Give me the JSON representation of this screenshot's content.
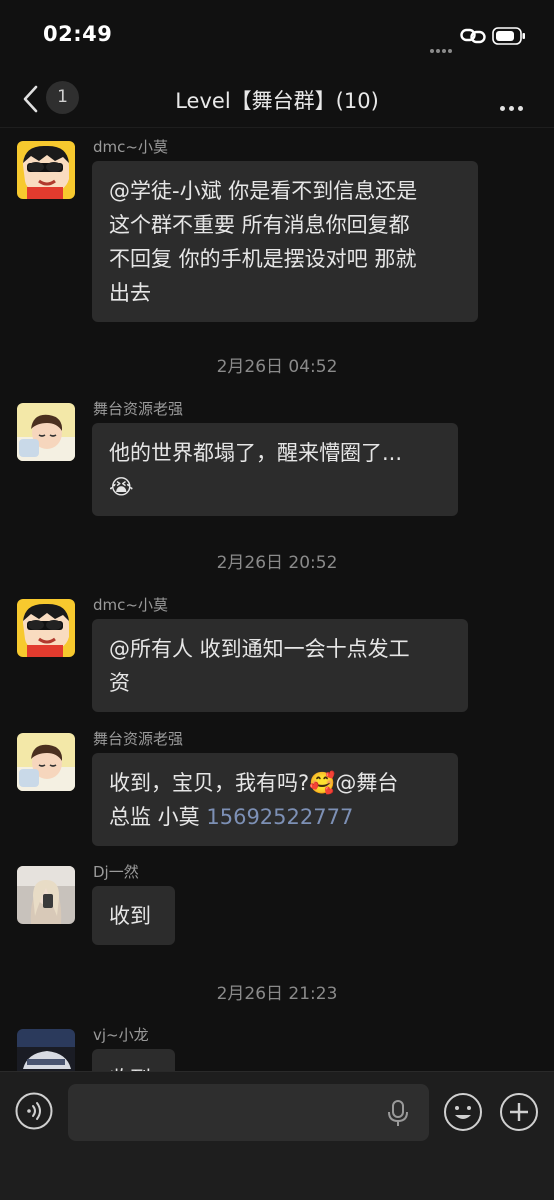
{
  "status_bar": {
    "time": "02:49"
  },
  "header": {
    "unread_count": "1",
    "title": "Level【舞台群】(10)"
  },
  "messages": [
    {
      "sender": "dmc~小莫",
      "avatar": "cartoon-boy-avatar",
      "lines": [
        "@学徒-小斌 你是看不到信息还是",
        "这个群不重要 所有消息你回复都",
        "不回复 你的手机是摆设对吧 那就",
        "出去"
      ]
    },
    {
      "sender": "舞台资源老强",
      "avatar": "sleeping-boy-avatar",
      "lines": [
        "他的世界都塌了，醒来懵圈了..."
      ],
      "emoji": "😭"
    },
    {
      "sender": "dmc~小莫",
      "avatar": "cartoon-boy-avatar",
      "lines": [
        "@所有人 收到通知一会十点发工",
        "资"
      ]
    },
    {
      "sender": "舞台资源老强",
      "avatar": "sleeping-boy-avatar",
      "line1": "收到，宝贝，我有吗?",
      "line1_emoji": "🥰",
      "line1_tail": "@舞台",
      "line2": "总监 小莫 ",
      "phone": "15692522777"
    },
    {
      "sender": "Dj一然",
      "avatar": "girl-photo-avatar",
      "lines": [
        "收到"
      ]
    },
    {
      "sender": "vj~小龙",
      "avatar": "car-photo-avatar",
      "lines": [
        "收到"
      ]
    }
  ],
  "timestamps": [
    "2月26日 04:52",
    "2月26日 20:52",
    "2月26日 21:23"
  ],
  "input": {
    "placeholder": ""
  },
  "colors": {
    "background": "#111111",
    "bubble": "#2c2c2c",
    "link": "#7d90b5"
  }
}
